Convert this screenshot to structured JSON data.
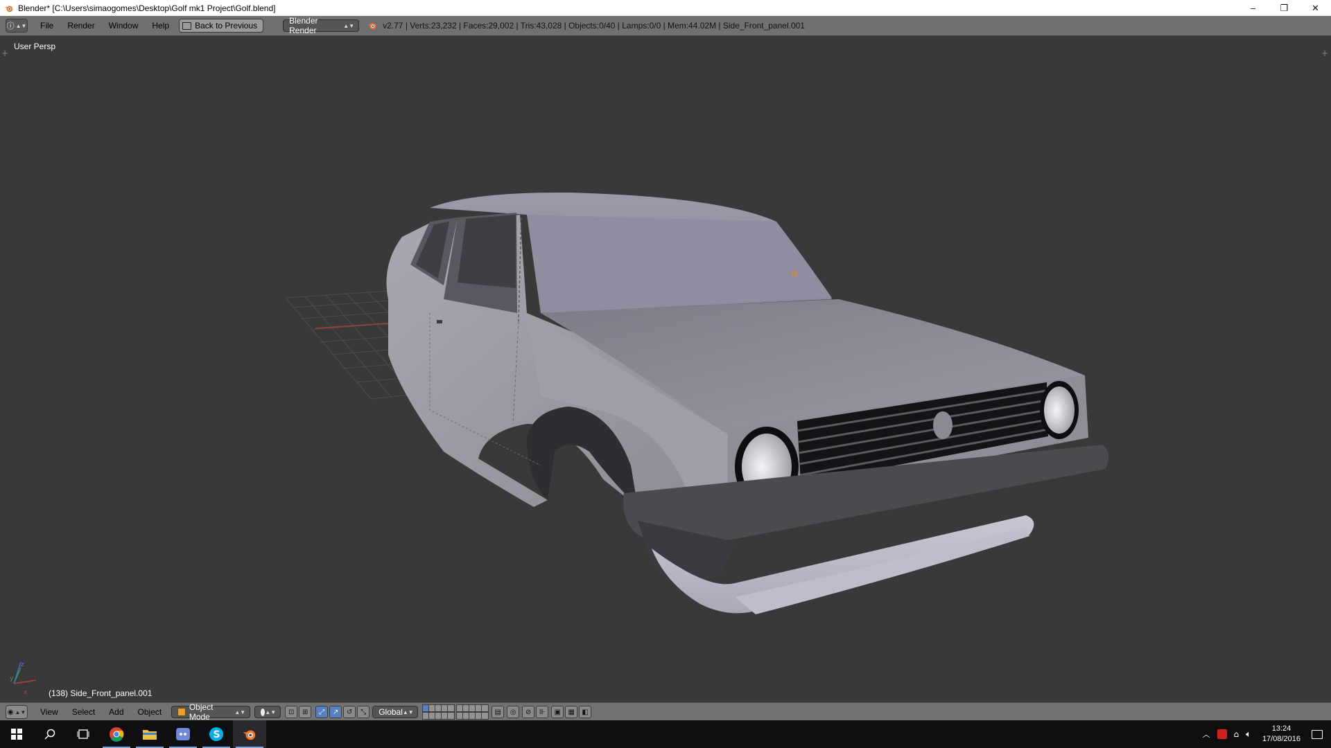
{
  "window": {
    "title": "Blender* [C:\\Users\\simaogomes\\Desktop\\Golf mk1 Project\\Golf.blend]",
    "minimize": "–",
    "restore": "❐",
    "close": "✕"
  },
  "info_header": {
    "menus": [
      "File",
      "Render",
      "Window",
      "Help"
    ],
    "back_button": "Back to Previous",
    "render_engine": "Blender Render",
    "stats": "v2.77 | Verts:23,232 | Faces:29,002 | Tris:43,028 | Objects:0/40 | Lamps:0/0 | Mem:44.02M | Side_Front_panel.001"
  },
  "viewport": {
    "view_label": "User Persp",
    "object_label": "(138) Side_Front_panel.001"
  },
  "view3d_header": {
    "menus": [
      "View",
      "Select",
      "Add",
      "Object"
    ],
    "mode": "Object Mode",
    "orientation": "Global"
  },
  "taskbar": {
    "apps": [
      "start-icon",
      "search-icon",
      "task-view-icon",
      "chrome-icon",
      "file-explorer-icon",
      "discord-icon",
      "skype-icon",
      "blender-icon"
    ],
    "time": "13:24",
    "date": "17/08/2016"
  },
  "colors": {
    "viewport_bg": "#393939",
    "header_bg": "#727272",
    "accent_blue": "#5680c2",
    "blender_orange": "#f5792a"
  }
}
